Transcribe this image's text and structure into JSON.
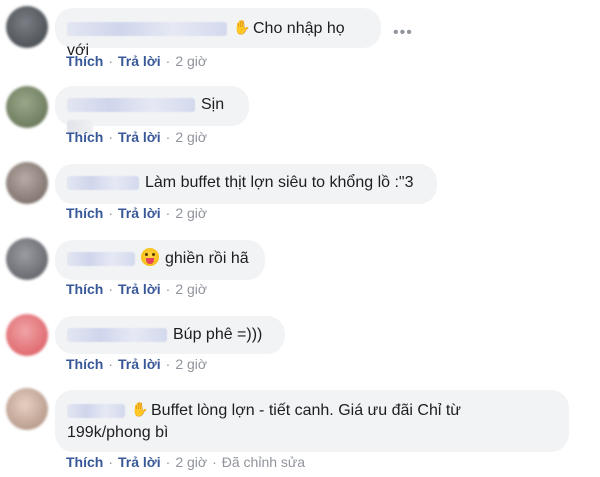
{
  "actions": {
    "like": "Thích",
    "reply": "Trả lời",
    "dot": "·"
  },
  "more_label": "•••",
  "comments": [
    {
      "text": "Cho nhập họ với",
      "time": "2 giờ"
    },
    {
      "text": "Sịn",
      "time": "2 giờ"
    },
    {
      "text": "Làm buffet thịt lợn siêu to khổng lồ :\"3",
      "time": "2 giờ"
    },
    {
      "text": "ghiền rồi hã",
      "time": "2 giờ"
    },
    {
      "text": "Búp phê =)))",
      "time": "2 giờ"
    },
    {
      "text_line1": "Buffet lòng lợn - tiết canh. Giá ưu đãi Chỉ từ",
      "text_line2": "199k/phong bì",
      "time": "2 giờ",
      "edited": "Đã chỉnh sửa"
    }
  ]
}
